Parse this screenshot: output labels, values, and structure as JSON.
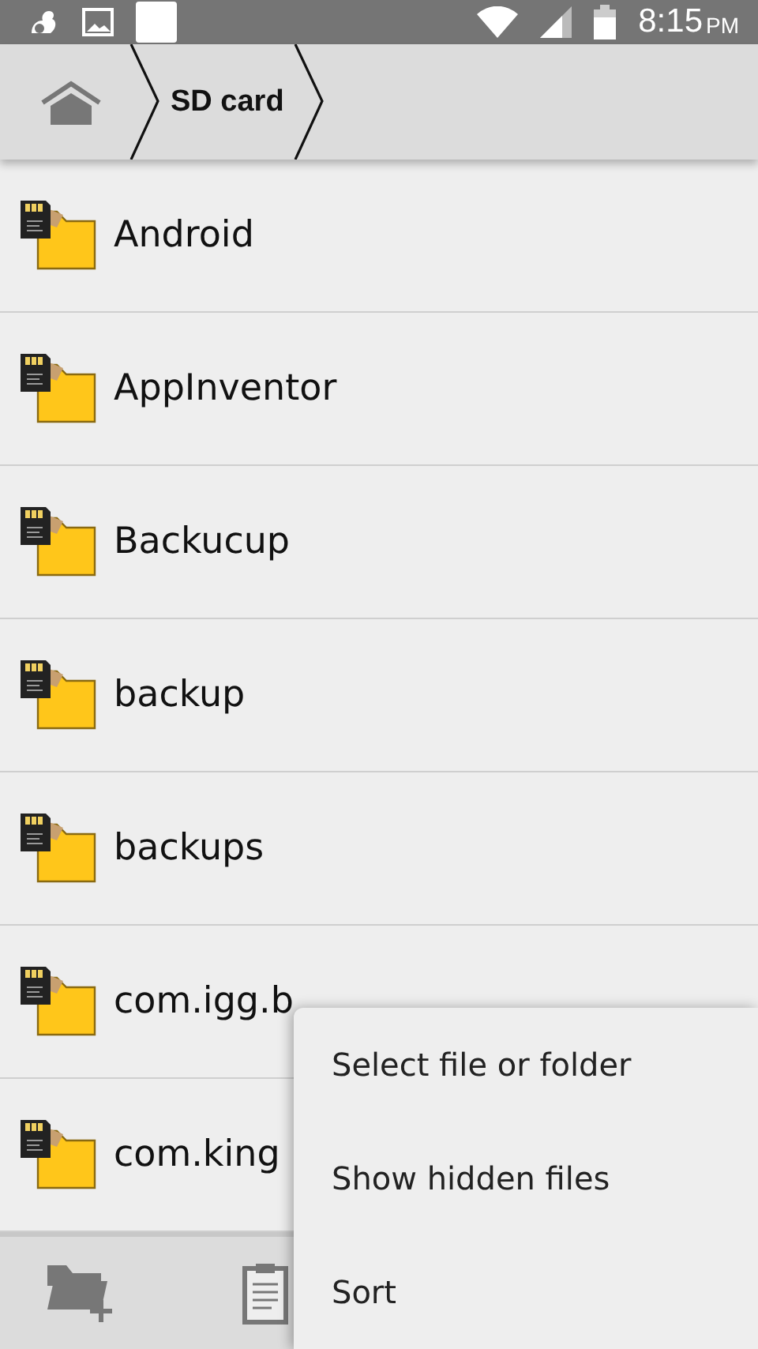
{
  "status_bar": {
    "time": "8:15",
    "ampm": "PM"
  },
  "breadcrumb": [
    {
      "label": "SD card"
    }
  ],
  "folders": [
    {
      "name": "Android"
    },
    {
      "name": "AppInventor"
    },
    {
      "name": "Backucup"
    },
    {
      "name": "backup"
    },
    {
      "name": "backups"
    },
    {
      "name": "com.igg.b"
    },
    {
      "name": "com.king"
    }
  ],
  "menu": {
    "items": [
      "Select file or folder",
      "Show hidden files",
      "Sort"
    ]
  }
}
